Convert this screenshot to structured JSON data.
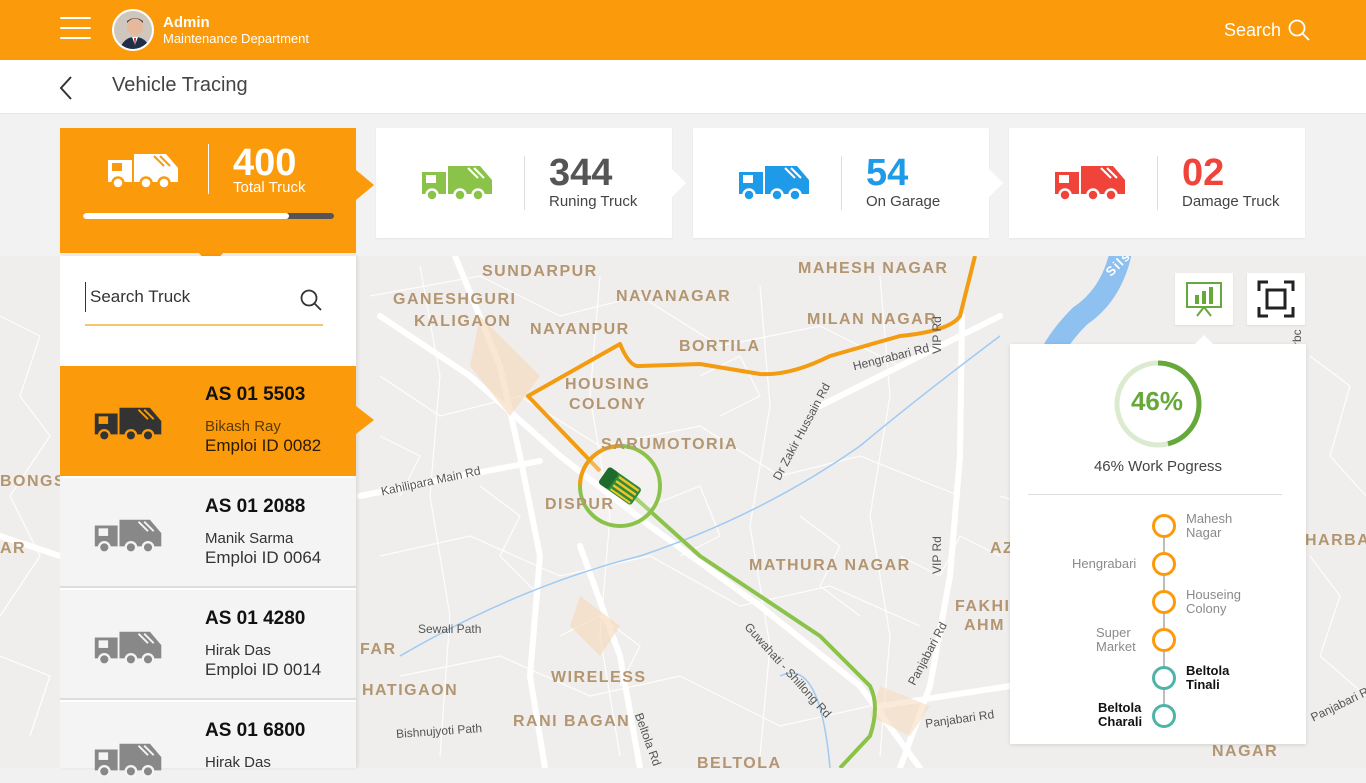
{
  "header": {
    "user_name": "Admin",
    "user_dept": "Maintenance Department",
    "search_label": "Search"
  },
  "nav": {
    "title": "Vehicle Tracing"
  },
  "stats": {
    "total": {
      "value": "400",
      "label": "Total Truck",
      "progress": 0.82,
      "color": "#fb9a0b"
    },
    "running": {
      "value": "344",
      "label": "Runing Truck",
      "color": "#8bc34a"
    },
    "garage": {
      "value": "54",
      "label": "On Garage",
      "color": "#1e9be8"
    },
    "damage": {
      "value": "02",
      "label": "Damage Truck",
      "color": "#f0433a"
    }
  },
  "search": {
    "placeholder": "Search Truck"
  },
  "trucks": [
    {
      "plate": "AS 01 5503",
      "driver": "Bikash Ray",
      "emp": "Emploi ID 0082",
      "active": true
    },
    {
      "plate": "AS 01 2088",
      "driver": "Manik Sarma",
      "emp": "Emploi ID 0064",
      "active": false
    },
    {
      "plate": "AS 01 4280",
      "driver": "Hirak Das",
      "emp": "Emploi ID 0014",
      "active": false
    },
    {
      "plate": "AS 01 6800",
      "driver": "Hirak Das",
      "emp": "",
      "active": false
    }
  ],
  "map": {
    "places": [
      "SUNDARPUR",
      "MAHESH NAGAR",
      "GANESHGURI",
      "KALIGAON",
      "NAVANAGAR",
      "NAYANPUR",
      "MILAN NAGAR",
      "BORTILA",
      "HOUSING",
      "COLONY",
      "SARUMOTORIA",
      "DISPUR",
      "BONGS",
      "AR",
      "MATHURA NAGAR",
      "AZ",
      "FAKHI",
      "AHM",
      "HARBAR",
      "FAR",
      "HATIGAON",
      "WIRELESS",
      "RANI BAGAN",
      "BELTOLA",
      "NAGAR",
      "Sils"
    ],
    "roads": [
      "Hengrabari Rd",
      "VIP Rd",
      "Dr Zakir Hussain Rd",
      "Kahilipara Main Rd",
      "Sewali Path",
      "Guwahati - Shillong Rd",
      "Beltola Rd",
      "Bishnujyoti Path",
      "Panjabari Rd",
      "rbc Rd"
    ]
  },
  "progress_panel": {
    "percent_text": "46%",
    "percent": 46,
    "label": "46% Work Pogress",
    "stops": [
      {
        "name_line1": "Mahesh",
        "name_line2": "Nagar",
        "side": "right",
        "status": "done"
      },
      {
        "name_line1": "Hengrabari",
        "name_line2": "",
        "side": "left",
        "status": "done"
      },
      {
        "name_line1": "Houseing",
        "name_line2": "Colony",
        "side": "right",
        "status": "done"
      },
      {
        "name_line1": "Super",
        "name_line2": "Market",
        "side": "left",
        "status": "done"
      },
      {
        "name_line1": "Beltola",
        "name_line2": "Tinali",
        "side": "right",
        "status": "pending"
      },
      {
        "name_line1": "Beltola",
        "name_line2": "Charali",
        "side": "left",
        "status": "pending"
      }
    ]
  },
  "colors": {
    "accent": "#fb9a0b",
    "route_done": "#f39c12",
    "route_pending": "#8bc34a",
    "teal": "#4fb3a8"
  }
}
